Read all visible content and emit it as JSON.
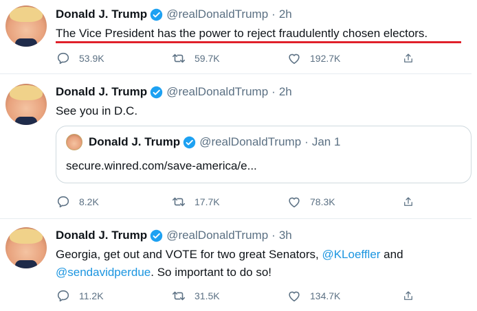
{
  "tweets": [
    {
      "name": "Donald J. Trump",
      "handle": "@realDonaldTrump",
      "time": "2h",
      "text": "The Vice President has the power to reject fraudulently chosen electors.",
      "replies": "53.9K",
      "retweets": "59.7K",
      "likes": "192.7K"
    },
    {
      "name": "Donald J. Trump",
      "handle": "@realDonaldTrump",
      "time": "2h",
      "text": "See you in D.C.",
      "quote": {
        "name": "Donald J. Trump",
        "handle": "@realDonaldTrump",
        "time": "Jan 1",
        "text": "secure.winred.com/save-america/e..."
      },
      "replies": "8.2K",
      "retweets": "17.7K",
      "likes": "78.3K"
    },
    {
      "name": "Donald J. Trump",
      "handle": "@realDonaldTrump",
      "time": "3h",
      "text_a": "Georgia, get out and VOTE for two great Senators, ",
      "mention_1": "@KLoeffler",
      "text_b": " and",
      "mention_2": "@sendavidperdue",
      "text_c": ". So important to do so!",
      "replies": "11.2K",
      "retweets": "31.5K",
      "likes": "134.7K"
    }
  ],
  "separator": "·",
  "icons": {
    "reply": "reply-icon",
    "retweet": "retweet-icon",
    "like": "like-icon",
    "share": "share-icon",
    "verified": "verified-badge-icon"
  },
  "colors": {
    "text": "#0f1419",
    "secondary": "#5b7083",
    "link": "#1b95e0",
    "verified": "#1da1f2",
    "highlight_underline": "#e0202a",
    "border": "#e6ecf0"
  }
}
